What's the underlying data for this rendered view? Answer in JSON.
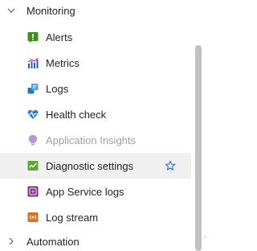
{
  "groups": {
    "monitoring": {
      "label": "Monitoring",
      "expanded": true
    },
    "automation": {
      "label": "Automation",
      "expanded": false
    }
  },
  "items": [
    {
      "label": "Alerts",
      "icon": "alerts-icon",
      "color": "#3e8e1f"
    },
    {
      "label": "Metrics",
      "icon": "metrics-icon",
      "color": "#2b5fb4"
    },
    {
      "label": "Logs",
      "icon": "logs-icon",
      "color": "#1c7bd1"
    },
    {
      "label": "Health check",
      "icon": "health-check-icon",
      "color": "#2a82d4"
    },
    {
      "label": "Application Insights",
      "icon": "application-insights-icon",
      "color": "#b596d6",
      "disabled": true
    },
    {
      "label": "Diagnostic settings",
      "icon": "diagnostic-settings-icon",
      "color": "#5ea734",
      "selected": true,
      "favorite": true
    },
    {
      "label": "App Service logs",
      "icon": "app-service-logs-icon",
      "color": "#7b2b7b"
    },
    {
      "label": "Log stream",
      "icon": "log-stream-icon",
      "color": "#e06c1c"
    }
  ],
  "colors": {
    "text": "#242424",
    "disabled_text": "#a19f9d",
    "selected_bg": "#f0f0f0",
    "star": "#2b6fd6",
    "scrollbar": "#c1c1c1"
  }
}
